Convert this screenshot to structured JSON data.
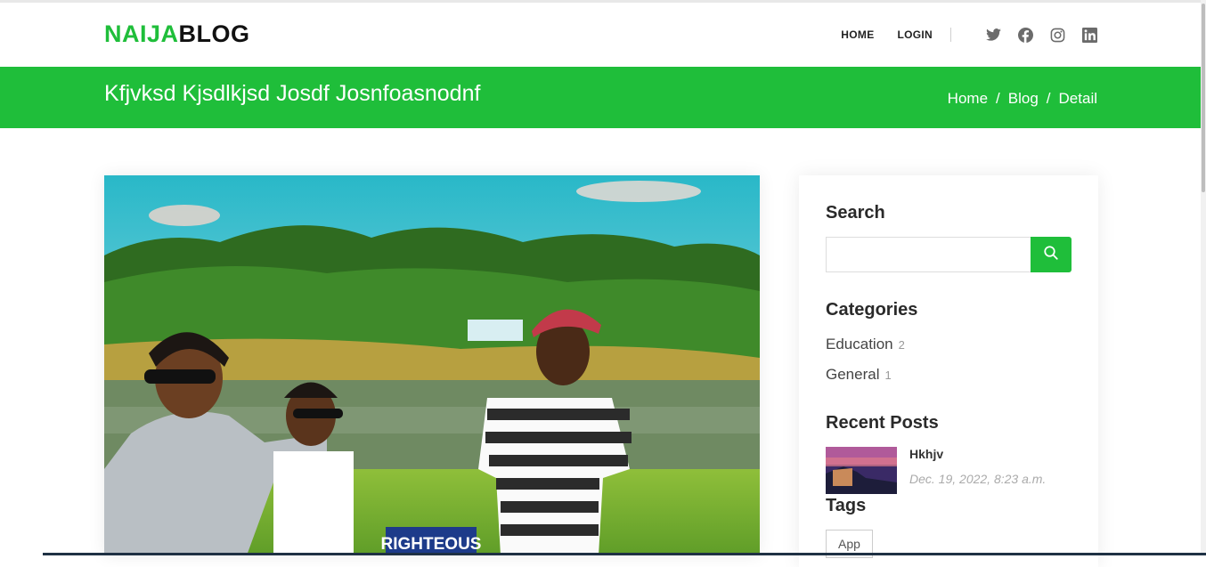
{
  "header": {
    "logo_part1": "NAIJA",
    "logo_part2": "BLOG",
    "nav": {
      "home": "HOME",
      "login": "LOGIN"
    },
    "social_icons": [
      "twitter-icon",
      "facebook-icon",
      "instagram-icon",
      "linkedin-icon"
    ]
  },
  "banner": {
    "title": "Kfjvksd Kjsdlkjsd Josdf Josnfoasnodnf",
    "breadcrumb": [
      "Home",
      "Blog",
      "Detail"
    ],
    "separator": "/"
  },
  "post_image": {
    "sign_text": "RIGHTEOUS"
  },
  "sidebar": {
    "search_heading": "Search",
    "search_value": "",
    "categories_heading": "Categories",
    "categories": [
      {
        "name": "Education",
        "count": "2"
      },
      {
        "name": "General",
        "count": "1"
      }
    ],
    "recent_heading": "Recent Posts",
    "recent_posts": [
      {
        "title": "Hkhjv",
        "date": "Dec. 19, 2022, 8:23 a.m."
      }
    ],
    "tags_heading": "Tags",
    "tags": [
      "App"
    ]
  },
  "colors": {
    "accent": "#1fbe3a",
    "text_dark": "#111111"
  }
}
